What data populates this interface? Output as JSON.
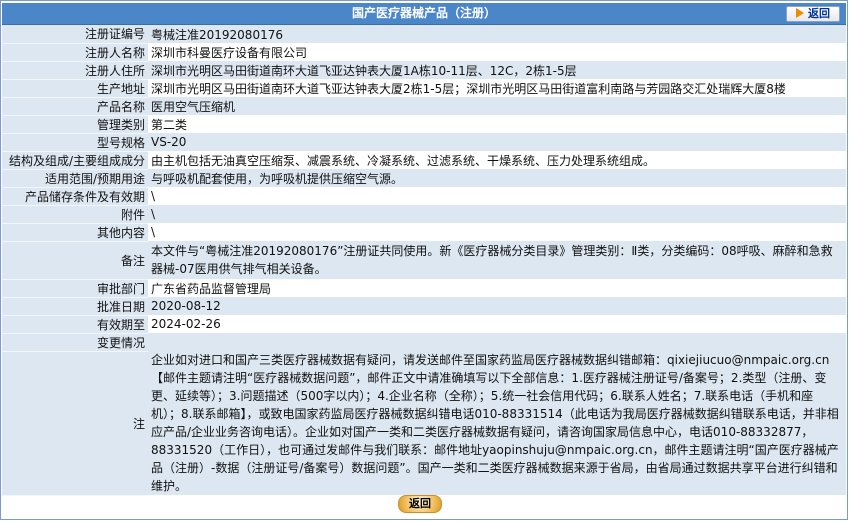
{
  "header": {
    "title": "国产医疗器械产品（注册）",
    "back_label": "返回"
  },
  "rows": [
    {
      "label": "注册证编号",
      "value": "粤械注准20192080176"
    },
    {
      "label": "注册人名称",
      "value": "深圳市科曼医疗设备有限公司"
    },
    {
      "label": "注册人住所",
      "value": "深圳市光明区马田街道南环大道飞亚达钟表大厦1A栋10-11层、12C，2栋1-5层"
    },
    {
      "label": "生产地址",
      "value": "深圳市光明区马田街道南环大道飞亚达钟表大厦2栋1-5层；深圳市光明区马田街道富利南路与芳园路交汇处瑞辉大厦8楼"
    },
    {
      "label": "产品名称",
      "value": "医用空气压缩机"
    },
    {
      "label": "管理类别",
      "value": "第二类"
    },
    {
      "label": "型号规格",
      "value": "VS-20"
    },
    {
      "label": "结构及组成/主要组成成分",
      "value": "由主机包括无油真空压缩泵、减震系统、冷凝系统、过滤系统、干燥系统、压力处理系统组成。"
    },
    {
      "label": "适用范围/预期用途",
      "value": "与呼吸机配套使用，为呼吸机提供压缩空气源。"
    },
    {
      "label": "产品储存条件及有效期",
      "value": "\\"
    },
    {
      "label": "附件",
      "value": "\\"
    },
    {
      "label": "其他内容",
      "value": "\\"
    },
    {
      "label": "备注",
      "value": "本文件与“粤械注准20192080176”注册证共同使用。新《医疗器械分类目录》管理类别：Ⅱ类，分类编码：08呼吸、麻醉和急救器械-07医用供气排气相关设备。"
    },
    {
      "label": "审批部门",
      "value": "广东省药品监督管理局"
    },
    {
      "label": "批准日期",
      "value": "2020-08-12"
    },
    {
      "label": "有效期至",
      "value": "2024-02-26"
    },
    {
      "label": "变更情况",
      "value": ""
    },
    {
      "label": "注",
      "value": "企业如对进口和国产三类医疗器械数据有疑问，请发送邮件至国家药监局医疗器械数据纠错邮箱：qixiejiucuo@nmpaic.org.cn【邮件主题请注明“医疗器械数据问题”，邮件正文中请准确填写以下全部信息：1.医疗器械注册证号/备案号；2.类型（注册、变更、延续等）；3.问题描述（500字以内）；4.企业名称（全称）；5.统一社会信用代码；6.联系人姓名；7.联系电话（手机和座机）；8.联系邮箱】，或致电国家药监局医疗器械数据纠错电话010-88331514（此电话为我局医疗器械数据纠错联系电话，并非相应产品/企业业务咨询电话）。企业如对国产一类和二类医疗器械数据有疑问，请咨询国家局信息中心，电话010-88332877，88331520（工作日），也可通过发邮件与我们联系：邮件地址yaopinshuju@nmpaic.org.cn，邮件主题请注明“国产医疗器械产品（注册）-数据（注册证号/备案号）数据问题”。国产一类和二类医疗器械数据来源于省局，由省局通过数据共享平台进行纠错和维护。"
    }
  ],
  "footer": {
    "back_label": "返回"
  }
}
